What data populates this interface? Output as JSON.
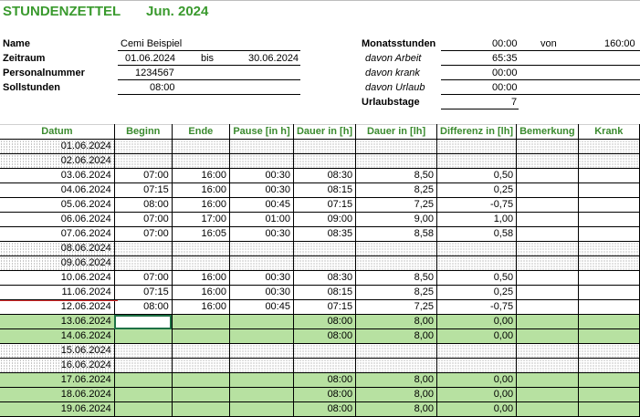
{
  "header": {
    "title": "STUNDENZETTEL",
    "month": "Jun. 2024"
  },
  "info": {
    "name_label": "Name",
    "name_value": "Cemi Beispiel",
    "period_label": "Zeitraum",
    "period_from": "01.06.2024",
    "period_bis": "bis",
    "period_to": "30.06.2024",
    "pnr_label": "Personalnummer",
    "pnr_value": "1234567",
    "soll_label": "Sollstunden",
    "soll_value": "08:00"
  },
  "summary": {
    "monat_label": "Monatsstunden",
    "monat_value": "00:00",
    "von_label": "von",
    "von_value": "160:00",
    "arbeit_label": "davon Arbeit",
    "arbeit_value": "65:35",
    "krank_label": "davon krank",
    "krank_value": "00:00",
    "urlaub_label": "davon Urlaub",
    "urlaub_value": "00:00",
    "urlaubstage_label": "Urlaubstage",
    "urlaubstage_value": "7"
  },
  "table": {
    "columns": [
      "Datum",
      "Beginn",
      "Ende",
      "Pause [in h]",
      "Dauer in [h]",
      "Dauer in [lh]",
      "Differenz in [lh]",
      "Bemerkung",
      "Krank"
    ],
    "rows": [
      {
        "type": "weekend",
        "cells": [
          "01.06.2024",
          "",
          "",
          "",
          "",
          "",
          "",
          "",
          ""
        ]
      },
      {
        "type": "weekend",
        "cells": [
          "02.06.2024",
          "",
          "",
          "",
          "",
          "",
          "",
          "",
          ""
        ]
      },
      {
        "type": "work",
        "cells": [
          "03.06.2024",
          "07:00",
          "16:00",
          "00:30",
          "08:30",
          "8,50",
          "0,50",
          "",
          ""
        ]
      },
      {
        "type": "work",
        "cells": [
          "04.06.2024",
          "07:15",
          "16:00",
          "00:30",
          "08:15",
          "8,25",
          "0,25",
          "",
          ""
        ]
      },
      {
        "type": "work",
        "cells": [
          "05.06.2024",
          "08:00",
          "16:00",
          "00:45",
          "07:15",
          "7,25",
          "-0,75",
          "",
          ""
        ]
      },
      {
        "type": "work",
        "cells": [
          "06.06.2024",
          "07:00",
          "17:00",
          "01:00",
          "09:00",
          "9,00",
          "1,00",
          "",
          ""
        ]
      },
      {
        "type": "work",
        "cells": [
          "07.06.2024",
          "07:00",
          "16:05",
          "00:30",
          "08:35",
          "8,58",
          "0,58",
          "",
          ""
        ]
      },
      {
        "type": "weekend",
        "cells": [
          "08.06.2024",
          "",
          "",
          "",
          "",
          "",
          "",
          "",
          ""
        ]
      },
      {
        "type": "weekend",
        "cells": [
          "09.06.2024",
          "",
          "",
          "",
          "",
          "",
          "",
          "",
          ""
        ]
      },
      {
        "type": "work",
        "cells": [
          "10.06.2024",
          "07:00",
          "16:00",
          "00:30",
          "08:30",
          "8,50",
          "0,50",
          "",
          ""
        ]
      },
      {
        "type": "work",
        "cells": [
          "11.06.2024",
          "07:15",
          "16:00",
          "00:30",
          "08:15",
          "8,25",
          "0,25",
          "",
          ""
        ]
      },
      {
        "type": "work",
        "cells": [
          "12.06.2024",
          "08:00",
          "16:00",
          "00:45",
          "07:15",
          "7,25",
          "-0,75",
          "",
          ""
        ]
      },
      {
        "type": "holiday",
        "cells": [
          "13.06.2024",
          "",
          "",
          "",
          "08:00",
          "8,00",
          "0,00",
          "",
          ""
        ]
      },
      {
        "type": "holiday",
        "cells": [
          "14.06.2024",
          "",
          "",
          "",
          "08:00",
          "8,00",
          "0,00",
          "",
          ""
        ]
      },
      {
        "type": "weekend",
        "cells": [
          "15.06.2024",
          "",
          "",
          "",
          "",
          "",
          "",
          "",
          ""
        ]
      },
      {
        "type": "weekend",
        "cells": [
          "16.06.2024",
          "",
          "",
          "",
          "",
          "",
          "",
          "",
          ""
        ]
      },
      {
        "type": "holiday",
        "cells": [
          "17.06.2024",
          "",
          "",
          "",
          "08:00",
          "8,00",
          "0,00",
          "",
          ""
        ]
      },
      {
        "type": "holiday",
        "cells": [
          "18.06.2024",
          "",
          "",
          "",
          "08:00",
          "8,00",
          "0,00",
          "",
          ""
        ]
      },
      {
        "type": "holiday",
        "cells": [
          "19.06.2024",
          "",
          "",
          "",
          "08:00",
          "8,00",
          "0,00",
          "",
          ""
        ]
      }
    ]
  }
}
